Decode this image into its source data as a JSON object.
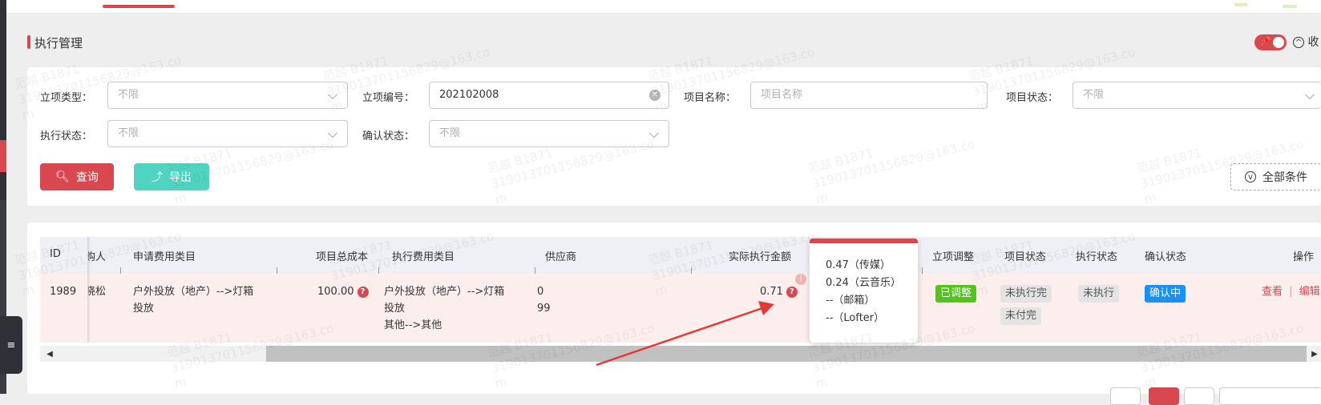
{
  "title": "执行管理",
  "collapse_label": "收",
  "filters": {
    "project_type": {
      "label": "立项类型：",
      "placeholder": "不限"
    },
    "project_no": {
      "label": "立项编号：",
      "value": "202102008"
    },
    "project_name": {
      "label": "项目名称：",
      "placeholder": "项目名称"
    },
    "project_status": {
      "label": "项目状态：",
      "placeholder": "不限"
    },
    "exec_status": {
      "label": "执行状态：",
      "placeholder": "不限"
    },
    "confirm_status": {
      "label": "确认状态：",
      "placeholder": "不限"
    }
  },
  "buttons": {
    "query": "查询",
    "export": "导出",
    "all_conditions": "全部条件"
  },
  "table": {
    "columns": [
      "ID",
      "购人",
      "申请费用类目",
      "项目总成本",
      "执行费用类目",
      "供应商",
      "实际执行金额",
      "立项调整",
      "项目状态",
      "执行状态",
      "确认状态",
      "操作"
    ],
    "row": {
      "id": "1989",
      "buyer": "晓松",
      "apply_category": [
        "户外投放（地产）-->灯箱",
        "投放"
      ],
      "total_cost": "100.00",
      "exec_category": [
        "户外投放（地产）-->灯箱",
        "投放",
        "其他-->其他"
      ],
      "supplier": [
        "0",
        "99"
      ],
      "actual_amount": "0.71",
      "adjust_tag": "已调整",
      "project_status_tags": [
        "未执行完",
        "未付完"
      ],
      "exec_status_tag": "未执行",
      "confirm_status_tag": "确认中",
      "actions": {
        "view": "查看",
        "sep": "|",
        "edit": "编辑"
      }
    }
  },
  "tooltip": {
    "lines": [
      "0.47（传媒）",
      "0.24（云音乐）",
      "--（邮箱）",
      "--（Lofter）"
    ]
  },
  "watermark": {
    "line1": "范越 B1871",
    "line2": "319013701156829@163.co",
    "line3": "m"
  },
  "colors": {
    "accent": "#d9474f",
    "teal": "#4ed4bf",
    "green": "#52c41a",
    "blue": "#1890ff"
  }
}
